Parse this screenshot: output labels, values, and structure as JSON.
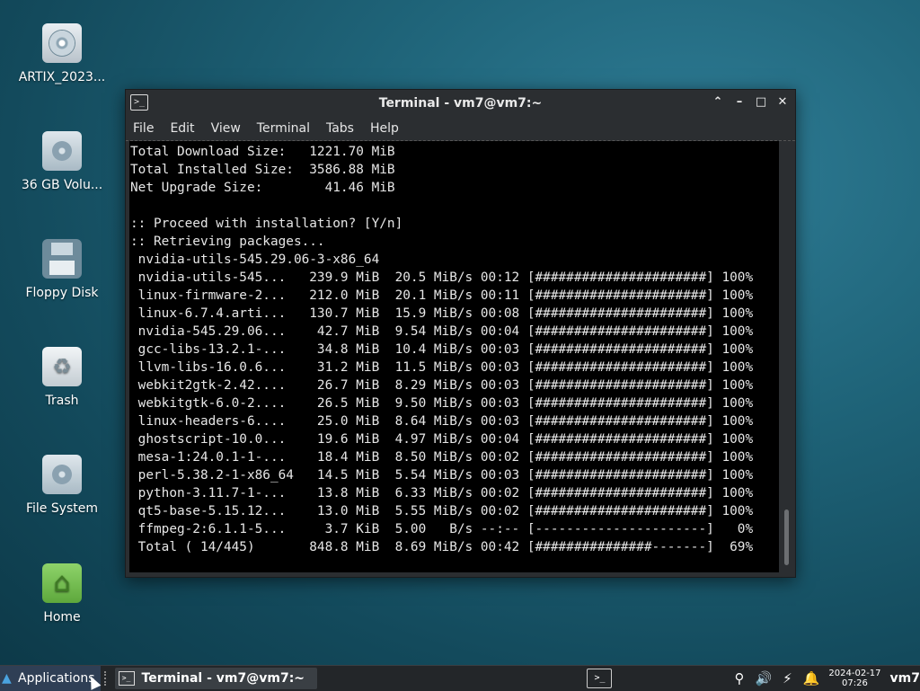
{
  "desktop": {
    "icons": [
      {
        "label": "ARTIX_2023...",
        "icon": "optical-disc-icon"
      },
      {
        "label": "36 GB Volu...",
        "icon": "hard-drive-icon"
      },
      {
        "label": "Floppy Disk",
        "icon": "floppy-disk-icon"
      },
      {
        "label": "Trash",
        "icon": "trash-icon"
      },
      {
        "label": "File System",
        "icon": "hard-drive-icon"
      },
      {
        "label": "Home",
        "icon": "home-folder-icon"
      }
    ]
  },
  "window": {
    "title": "Terminal - vm7@vm7:~",
    "menu": [
      "File",
      "Edit",
      "View",
      "Terminal",
      "Tabs",
      "Help"
    ],
    "terminal_lines": [
      "Total Download Size:   1221.70 MiB",
      "Total Installed Size:  3586.88 MiB",
      "Net Upgrade Size:        41.46 MiB",
      "",
      ":: Proceed with installation? [Y/n]",
      ":: Retrieving packages...",
      " nvidia-utils-545.29.06-3-x86_64",
      " nvidia-utils-545...   239.9 MiB  20.5 MiB/s 00:12 [######################] 100%",
      " linux-firmware-2...   212.0 MiB  20.1 MiB/s 00:11 [######################] 100%",
      " linux-6.7.4.arti...   130.7 MiB  15.9 MiB/s 00:08 [######################] 100%",
      " nvidia-545.29.06...    42.7 MiB  9.54 MiB/s 00:04 [######################] 100%",
      " gcc-libs-13.2.1-...    34.8 MiB  10.4 MiB/s 00:03 [######################] 100%",
      " llvm-libs-16.0.6...    31.2 MiB  11.5 MiB/s 00:03 [######################] 100%",
      " webkit2gtk-2.42....    26.7 MiB  8.29 MiB/s 00:03 [######################] 100%",
      " webkitgtk-6.0-2....    26.5 MiB  9.50 MiB/s 00:03 [######################] 100%",
      " linux-headers-6....    25.0 MiB  8.64 MiB/s 00:03 [######################] 100%",
      " ghostscript-10.0...    19.6 MiB  4.97 MiB/s 00:04 [######################] 100%",
      " mesa-1:24.0.1-1-...    18.4 MiB  8.50 MiB/s 00:02 [######################] 100%",
      " perl-5.38.2-1-x86_64   14.5 MiB  5.54 MiB/s 00:03 [######################] 100%",
      " python-3.11.7-1-...    13.8 MiB  6.33 MiB/s 00:02 [######################] 100%",
      " qt5-base-5.15.12...    13.0 MiB  5.55 MiB/s 00:02 [######################] 100%",
      " ffmpeg-2:6.1.1-5...     3.7 KiB  5.00   B/s --:-- [----------------------]   0%",
      " Total ( 14/445)       848.8 MiB  8.69 MiB/s 00:42 [###############-------]  69%"
    ]
  },
  "taskbar": {
    "applications_label": "Applications",
    "task_label": "Terminal - vm7@vm7:~",
    "date": "2024-02-17",
    "time": "07:26",
    "user": "vm7"
  }
}
